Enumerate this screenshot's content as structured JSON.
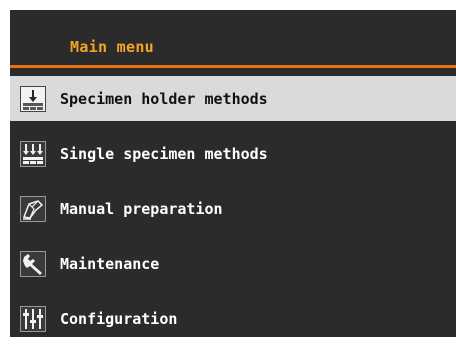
{
  "header": {
    "title": "Main menu"
  },
  "menu": {
    "items": [
      {
        "label": "Specimen holder methods",
        "icon": "specimen-holder-icon",
        "selected": true
      },
      {
        "label": "Single specimen methods",
        "icon": "single-specimen-icon",
        "selected": false
      },
      {
        "label": "Manual preparation",
        "icon": "manual-preparation-icon",
        "selected": false
      },
      {
        "label": "Maintenance",
        "icon": "wrench-icon",
        "selected": false
      },
      {
        "label": "Configuration",
        "icon": "sliders-icon",
        "selected": false
      }
    ]
  },
  "colors": {
    "background": "#2b2b2b",
    "accent": "#e8730f",
    "title": "#f5a524",
    "selected_bg": "#dadada"
  }
}
